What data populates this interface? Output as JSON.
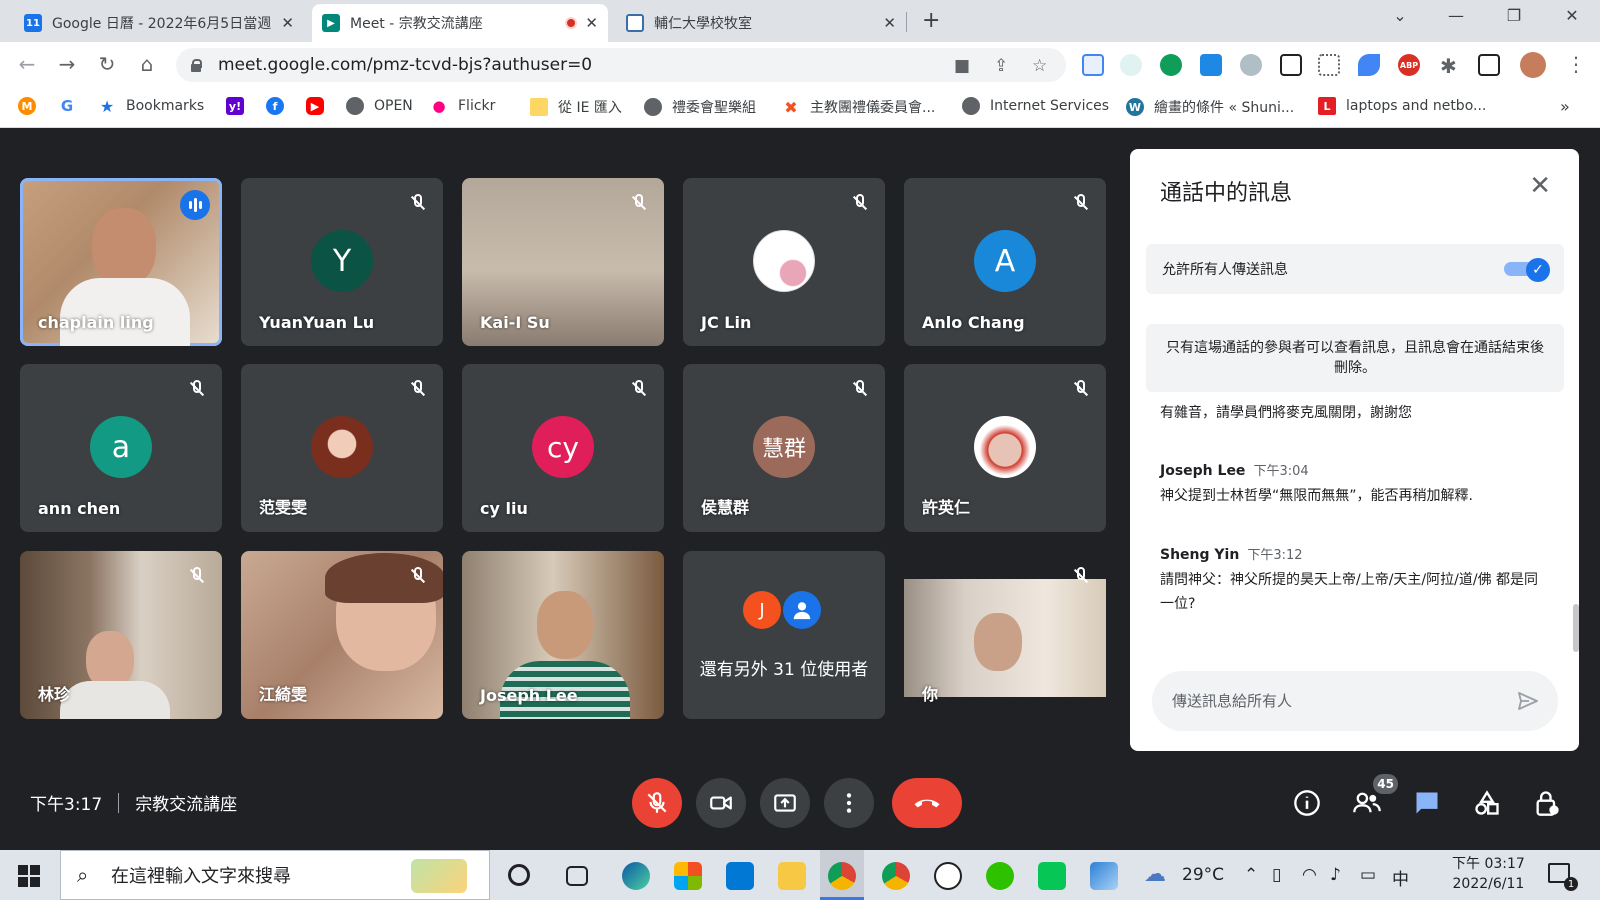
{
  "browser": {
    "tabs": [
      {
        "title": "Google 日曆 - 2022年6月5日當週",
        "favicon": "11"
      },
      {
        "title": "Meet - 宗教交流講座"
      },
      {
        "title": "輔仁大學校牧室"
      }
    ],
    "url": "meet.google.com/pmz-tcvd-bjs?authuser=0",
    "bookmarks": [
      "Bookmarks",
      "OPEN",
      "Flickr",
      "從 IE 匯入",
      "禮委會聖樂組",
      "主教團禮儀委員會...",
      "Internet Services",
      "繪畫的條件 « Shuni...",
      "laptops and netbo..."
    ]
  },
  "meet": {
    "participants": [
      {
        "name": "chaplain ling",
        "type": "video",
        "speaking": true
      },
      {
        "name": "YuanYuan Lu",
        "type": "avatar",
        "initial": "Y",
        "color": "#0b5345"
      },
      {
        "name": "Kai-I Su",
        "type": "video"
      },
      {
        "name": "JC Lin",
        "type": "photo"
      },
      {
        "name": "Anlo Chang",
        "type": "avatar",
        "initial": "A",
        "color": "#1a88d9"
      },
      {
        "name": "ann chen",
        "type": "avatar",
        "initial": "a",
        "color": "#129a84"
      },
      {
        "name": "范雯雯",
        "type": "photo"
      },
      {
        "name": "cy liu",
        "type": "avatar",
        "initial": "cy",
        "color": "#e01e5a"
      },
      {
        "name": "侯慧群",
        "type": "avatar",
        "initial": "慧群",
        "color": "#9c6a5a"
      },
      {
        "name": "許英仁",
        "type": "photo"
      },
      {
        "name": "林珍",
        "type": "video"
      },
      {
        "name": "江綺雯",
        "type": "video"
      },
      {
        "name": "Joseph Lee",
        "type": "video"
      },
      {
        "name": "還有另外 31 位使用者",
        "type": "others"
      },
      {
        "name": "你",
        "type": "video"
      }
    ],
    "others_initial": "J",
    "time": "下午3:17",
    "meeting_name": "宗教交流講座",
    "people_count": "45"
  },
  "chat": {
    "title": "通話中的訊息",
    "toggle_label": "允許所有人傳送訊息",
    "info": "只有這場通話的參與者可以查看訊息，且訊息會在通話結束後刪除。",
    "messages": [
      {
        "author": "",
        "time": "",
        "text": "有雜音，請學員們將麥克風關閉，謝謝您"
      },
      {
        "author": "Joseph Lee",
        "time": "下午3:04",
        "text": "神父提到士林哲學“無限而無無”，能否再稍加解釋."
      },
      {
        "author": "Sheng Yin",
        "time": "下午3:12",
        "text": "請問神父：神父所提的昊天上帝/上帝/天主/阿拉/道/佛 都是同一位?"
      }
    ],
    "input_placeholder": "傳送訊息給所有人"
  },
  "taskbar": {
    "search_placeholder": "在這裡輸入文字來搜尋",
    "weather": "29°C",
    "ime": "中",
    "clock_time": "下午 03:17",
    "clock_date": "2022/6/11",
    "notifications": "1"
  }
}
